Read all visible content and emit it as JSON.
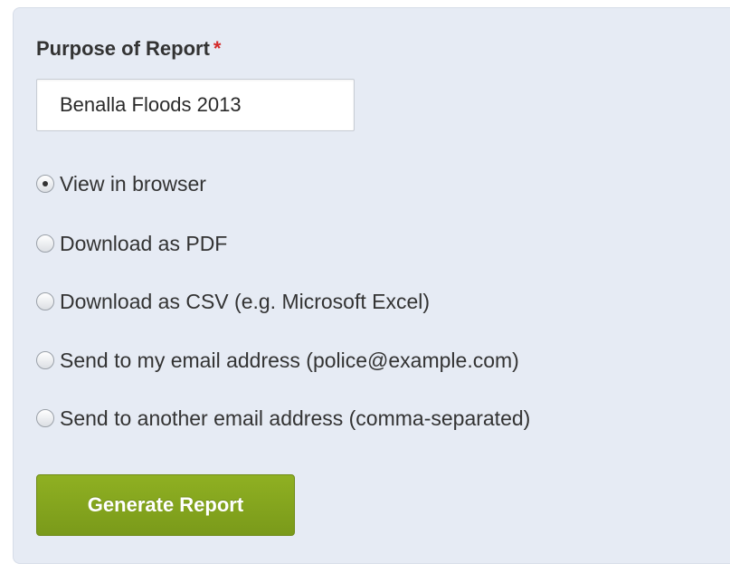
{
  "form": {
    "purpose_label": "Purpose of Report",
    "required_marker": "*",
    "purpose_value": "Benalla Floods 2013",
    "output_options": [
      {
        "label": "View in browser",
        "checked": true
      },
      {
        "label": "Download as PDF",
        "checked": false
      },
      {
        "label": "Download as CSV (e.g. Microsoft Excel)",
        "checked": false
      },
      {
        "label": "Send to my email address (police@example.com)",
        "checked": false
      },
      {
        "label": "Send to another email address (comma-separated)",
        "checked": false
      }
    ],
    "submit_label": "Generate Report"
  },
  "colors": {
    "panel_background": "#e6ebf4",
    "required_star": "#d42a2a",
    "button_green": "#7a9a1a",
    "text": "#333333"
  }
}
